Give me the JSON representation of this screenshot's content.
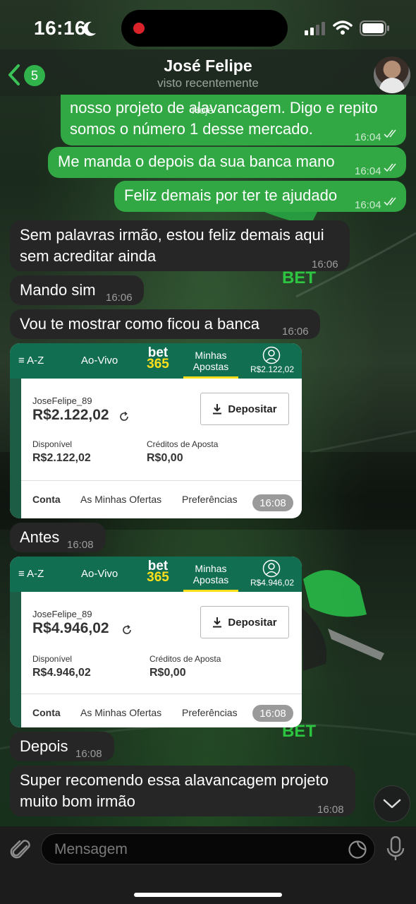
{
  "status_bar": {
    "time": "16:16"
  },
  "header": {
    "unread_count": "5",
    "contact_name": "José Felipe",
    "contact_status": "visto recentemente"
  },
  "chat": {
    "date_chip": "Hoje",
    "messages": [
      {
        "dir": "out",
        "line1": "nosso projeto de alavancagem. Digo e repito",
        "line2": "somos o número 1 desse mercado.",
        "time": "16:04"
      },
      {
        "dir": "out",
        "text": "Me manda o depois da sua banca mano",
        "time": "16:04"
      },
      {
        "dir": "out",
        "text": "Feliz demais por ter te ajudado",
        "time": "16:04"
      },
      {
        "dir": "in",
        "line1": "Sem palavras irmão, estou feliz demais aqui",
        "line2": "sem acreditar ainda",
        "time": "16:06"
      },
      {
        "dir": "in",
        "text": "Mando sim",
        "time": "16:06"
      },
      {
        "dir": "in",
        "text": "Vou te mostrar como ficou a banca",
        "time": "16:06"
      },
      {
        "dir": "in",
        "text": "Antes",
        "time": "16:08"
      },
      {
        "dir": "in",
        "text": "Depois",
        "time": "16:08"
      },
      {
        "dir": "in",
        "line1": "Super recomendo essa alavancagem projeto",
        "line2": "muito bom irmão",
        "time": "16:08"
      }
    ],
    "screenshots": [
      {
        "menu": "≡ A-Z",
        "live": "Ao-Vivo",
        "logo_top": "bet",
        "logo_bottom": "365",
        "minhas_1": "Minhas",
        "minhas_2": "Apostas",
        "top_balance": "R$2.122,02",
        "username": "JoseFelipe_89",
        "balance": "R$2.122,02",
        "deposit": "Depositar",
        "available_label": "Disponível",
        "available_value": "R$2.122,02",
        "credits_label": "Créditos de Aposta",
        "credits_value": "R$0,00",
        "tab_account": "Conta",
        "tab_offers": "As Minhas Ofertas",
        "tab_prefs": "Preferências",
        "time": "16:08"
      },
      {
        "menu": "≡ A-Z",
        "live": "Ao-Vivo",
        "logo_top": "bet",
        "logo_bottom": "365",
        "minhas_1": "Minhas",
        "minhas_2": "Apostas",
        "top_balance": "R$4.946,02",
        "username": "JoseFelipe_89",
        "balance": "R$4.946,02",
        "deposit": "Depositar",
        "available_label": "Disponível",
        "available_value": "R$4.946,02",
        "credits_label": "Créditos de Aposta",
        "credits_value": "R$0,00",
        "tab_account": "Conta",
        "tab_offers": "As Minhas Ofertas",
        "tab_prefs": "Preferências",
        "time": "16:08"
      }
    ],
    "background_logo_text": "BET"
  },
  "input": {
    "placeholder": "Mensagem"
  },
  "colors": {
    "outgoing": "#32a844",
    "incoming": "#262626",
    "bet365_green": "#126e51",
    "bet365_yellow": "#ffdf1b"
  }
}
